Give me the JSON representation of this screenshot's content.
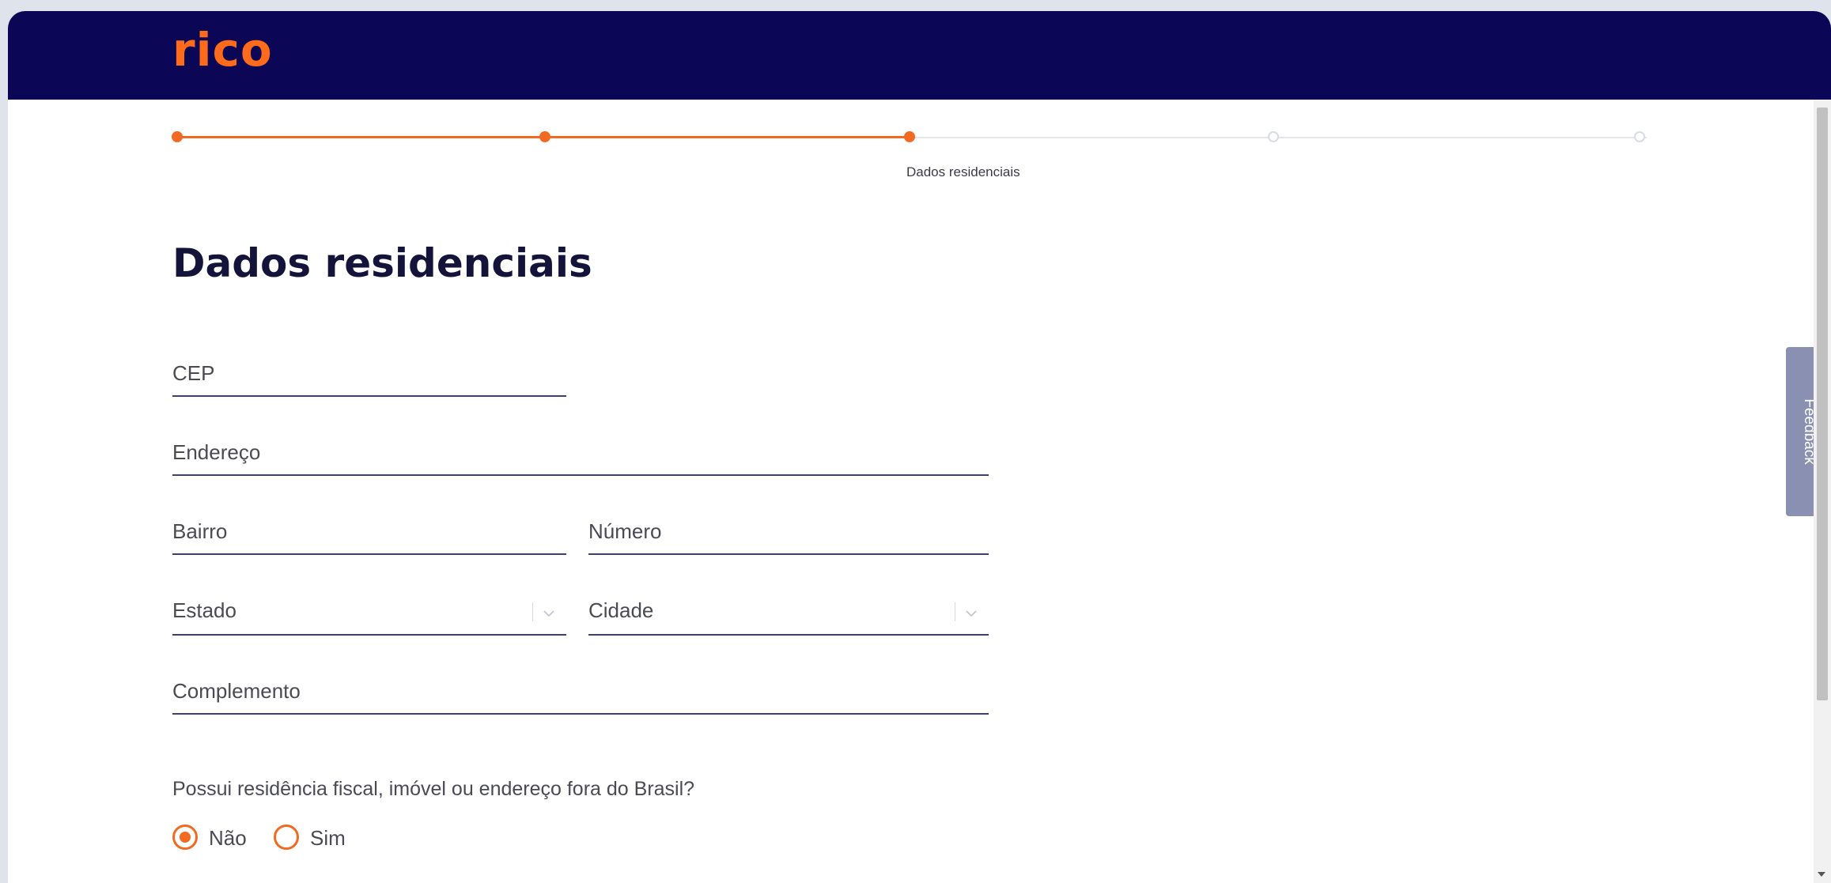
{
  "header": {
    "logo_text": "rico",
    "background": "#0b0656",
    "logo_color": "#ff6b1a"
  },
  "stepper": {
    "current_step": 3,
    "total_steps": 5,
    "current_label": "Dados residenciais",
    "accent": "#f26a21"
  },
  "page": {
    "title": "Dados residenciais"
  },
  "form": {
    "cep": {
      "placeholder": "CEP",
      "value": ""
    },
    "endereco": {
      "placeholder": "Endereço",
      "value": ""
    },
    "bairro": {
      "placeholder": "Bairro",
      "value": ""
    },
    "numero": {
      "placeholder": "Número",
      "value": ""
    },
    "estado": {
      "label": "Estado"
    },
    "cidade": {
      "label": "Cidade"
    },
    "complemento": {
      "placeholder": "Complemento",
      "value": ""
    },
    "question": "Possui residência fiscal, imóvel ou endereço fora do Brasil?",
    "options": [
      {
        "label": "Não",
        "selected": true
      },
      {
        "label": "Sim",
        "selected": false
      }
    ]
  },
  "feedback": {
    "label": "Feedback"
  }
}
